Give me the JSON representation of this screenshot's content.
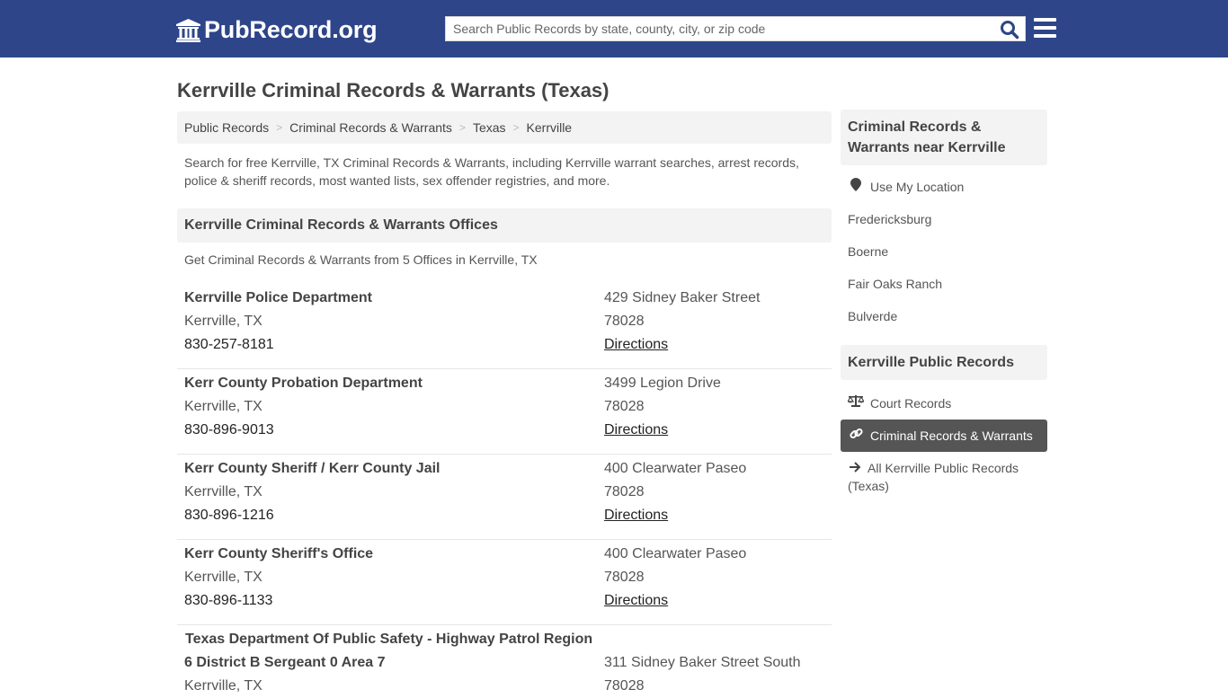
{
  "header": {
    "logo_text": "PubRecord.org",
    "search_placeholder": "Search Public Records by state, county, city, or zip code",
    "colors": {
      "topbar": "#2e4589",
      "search_icon": "#2e4589",
      "active_item": "#555555"
    }
  },
  "page": {
    "title": "Kerrville Criminal Records & Warrants (Texas)",
    "breadcrumb": [
      "Public Records",
      "Criminal Records & Warrants",
      "Texas",
      "Kerrville"
    ],
    "breadcrumb_separator": ">",
    "intro": "Search for free Kerrville, TX Criminal Records & Warrants, including Kerrville warrant searches, arrest records, police & sheriff records, most wanted lists, sex offender registries, and more.",
    "section_title": "Kerrville Criminal Records & Warrants Offices",
    "offices_note": "Get Criminal Records & Warrants from 5 Offices in Kerrville, TX",
    "directions_label": "Directions"
  },
  "offices": [
    {
      "name": "Kerrville Police Department",
      "city": "Kerrville, TX",
      "phone": "830-257-8181",
      "address": "429 Sidney Baker Street",
      "zip": "78028"
    },
    {
      "name": "Kerr County Probation Department",
      "city": "Kerrville, TX",
      "phone": "830-896-9013",
      "address": "3499 Legion Drive",
      "zip": "78028"
    },
    {
      "name": "Kerr County Sheriff / Kerr County Jail",
      "city": "Kerrville, TX",
      "phone": "830-896-1216",
      "address": "400 Clearwater Paseo",
      "zip": "78028"
    },
    {
      "name": "Kerr County Sheriff's Office",
      "city": "Kerrville, TX",
      "phone": "830-896-1133",
      "address": "400 Clearwater Paseo",
      "zip": "78028"
    },
    {
      "name_line1": "Texas Department Of Public Safety - Highway Patrol Region",
      "name_line2": "6 District B Sergeant 0 Area 7",
      "city": "Kerrville, TX",
      "address": "311 Sidney Baker Street South",
      "zip": "78028"
    }
  ],
  "sidebar": {
    "nearby_title": "Criminal Records & Warrants near Kerrville",
    "use_location": "Use My Location",
    "nearby": [
      "Fredericksburg",
      "Boerne",
      "Fair Oaks Ranch",
      "Bulverde"
    ],
    "records_title": "Kerrville Public Records",
    "records": [
      {
        "label": "Court Records",
        "icon": "balance-scale-icon"
      },
      {
        "label": "Criminal Records & Warrants",
        "icon": "link-icon",
        "active": true
      },
      {
        "label": "All Kerrville Public Records (Texas)",
        "icon": "arrow-right-icon"
      }
    ]
  }
}
